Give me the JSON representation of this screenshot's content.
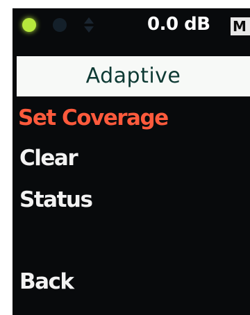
{
  "status": {
    "led_colors": [
      "#b6e83c",
      "#14202a"
    ],
    "arrows_icon": "up-down-arrows-icon",
    "level": "0.0 dB",
    "mode": "M"
  },
  "menu": {
    "title": "Adaptive",
    "items": [
      {
        "label": "Set Coverage",
        "selected": true
      },
      {
        "label": "Clear",
        "selected": false
      },
      {
        "label": "Status",
        "selected": false
      },
      {
        "label": "Back",
        "selected": false
      }
    ]
  },
  "colors": {
    "background": "#080a0c",
    "selected": "#ff5a3c",
    "text": "#f2f2f2",
    "header_bg": "#f7f9f7",
    "header_text": "#0e3a34"
  }
}
